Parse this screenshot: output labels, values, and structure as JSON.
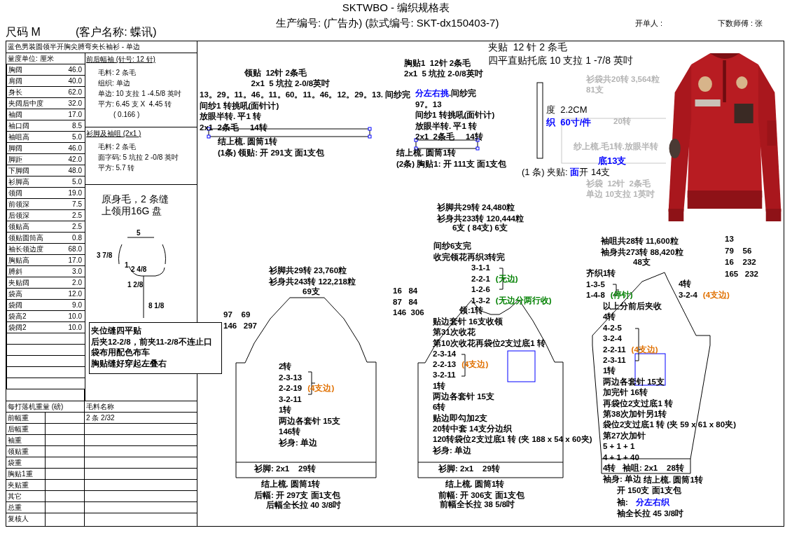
{
  "header": {
    "title": "SKTWBO - 编织规格表",
    "production_no": "生产编号: (广告办) (款式编号: SKT-dx150403-7)",
    "issuer": "开单人 :",
    "knitter": "下数师傅 : 张",
    "size": "尺码  M",
    "customer": "(客户名称: 蝶讯)"
  },
  "table": {
    "title": "蓝色男装圆领半开胸尖膊弯夹长袖衫 - 单边",
    "unit": "量度单位: 厘米",
    "measurements": [
      {
        "label": "胸阔",
        "value": "46.0"
      },
      {
        "label": "肩阔",
        "value": "40.0"
      },
      {
        "label": "身长",
        "value": "62.0"
      },
      {
        "label": "夹阔后中度",
        "value": "32.0"
      },
      {
        "label": "袖阔",
        "value": "17.0"
      },
      {
        "label": "袖口阔",
        "value": "8.5"
      },
      {
        "label": "袖咀高",
        "value": "5.0"
      },
      {
        "label": "脚阔",
        "value": "46.0"
      },
      {
        "label": "脚距",
        "value": "42.0"
      },
      {
        "label": "下脚阔",
        "value": "48.0"
      },
      {
        "label": "衫脚高",
        "value": "5.0"
      },
      {
        "label": "领阔",
        "value": "19.0"
      },
      {
        "label": "前领深",
        "value": "7.5"
      },
      {
        "label": "后领深",
        "value": "2.5"
      },
      {
        "label": "领贴高",
        "value": "2.5"
      },
      {
        "label": "领贴圆筒高",
        "value": "0.8"
      },
      {
        "label": "袖长领边度",
        "value": "68.0"
      },
      {
        "label": "胸贴高",
        "value": "17.0"
      },
      {
        "label": "膊斜",
        "value": "3.0"
      },
      {
        "label": "夹贴阔",
        "value": "2.0"
      },
      {
        "label": "袋高",
        "value": "12.0"
      },
      {
        "label": "袋阔",
        "value": "9.0"
      },
      {
        "label": "袋高2",
        "value": "10.0"
      },
      {
        "label": "袋阔2",
        "value": "10.0"
      }
    ]
  },
  "body_spec": {
    "heading": "前后幅袖 (针号: 12 针)",
    "lines": [
      "毛料: 2 条毛",
      "组织: 单边",
      "单边: 10 支拉 1 -4.5/8 英吋",
      "平方: 6.45 支 X  4.45 转",
      "( 0.166 )"
    ]
  },
  "rib_spec": {
    "heading": "衫脚及袖咀 (2x1  )",
    "lines": [
      "毛料: 2 条毛",
      "面字码: 5 坑拉 2 -0/8 英吋",
      "平方: 5.7 转"
    ]
  },
  "collar_note": [
    "原身毛，2 条缝",
    "上领用16G 盘"
  ],
  "neck_dims": [
    "5",
    "3 7/8",
    "1",
    "2 4/8",
    "1 2/8",
    "8 1/8"
  ],
  "sewing_note": [
    "夹位缝四平贴",
    "后夹12-2/8，前夹11-2/8不连止口",
    "袋布用配色布车",
    "胸贴缝好穿起左叠右"
  ],
  "weights": {
    "heading": "每打落机重量 (磅)",
    "yarn_heading": "毛料名称",
    "rows": [
      {
        "label": "前幅重",
        "yarn": "2 条 2/32"
      },
      {
        "label": "后幅重"
      },
      {
        "label": "袖重"
      },
      {
        "label": "领贴重"
      },
      {
        "label": "袋重"
      },
      {
        "label": "胸贴1重"
      },
      {
        "label": "夹贴重"
      },
      {
        "label": "其它"
      },
      {
        "label": "总重"
      },
      {
        "label": "复核人"
      }
    ]
  },
  "notes": [
    {
      "kind": "bold",
      "lines": [
        "领贴  12针 2条毛",
        "   2x1  5 坑拉 2-0/8英吋"
      ]
    },
    {
      "kind": "bold",
      "lines": [
        "13。29。11。46。11。60。11。46。12。29。13. 间纱完",
        "间纱1 转挑吼(面针计)",
        "放眼半转. 平1 转",
        "2x1  2条毛     14转"
      ]
    },
    {
      "kind": "bold",
      "lines": [
        "结上梳. 圆筒1转",
        "(1条) 领贴: 开 291支 面1支包"
      ]
    },
    {
      "kind": "bold",
      "lines": [
        "胸贴1  12针 2条毛",
        "2x1  5 坑拉 2-0/8英吋"
      ]
    },
    {
      "kind": "bold",
      "lines": [
        {
          "segments": [
            {
              "text": "分左右挑",
              "color": "#0000ff"
            },
            {
              "text": ".间纱完"
            }
          ]
        },
        "97。13",
        "间纱1 转挑吼(面针计)",
        "放眼半转. 平1 转",
        "2x1  2条毛     14转"
      ]
    },
    {
      "kind": "bold",
      "lines": [
        "结上梳. 圆筒1转",
        "(2条) 胸贴1: 开 111支 面1支包"
      ]
    },
    {
      "kind": "large",
      "lines": [
        "夹贴  12 针 2 条毛",
        "四平直贴托底 10 支拉 1 -7/8 英吋"
      ]
    },
    {
      "kind": "faded",
      "lines": [
        "衫袋共20转 3,564粒",
        "81支"
      ]
    },
    {
      "kind": "plain",
      "lines": [
        "度  2.2CM",
        {
          "segments": [
            {
              "text": "织  60寸/件",
              "color": "#0000ff"
            }
          ]
        }
      ]
    },
    {
      "kind": "faded",
      "lines": [
        "20转"
      ]
    },
    {
      "kind": "faded",
      "lines": [
        "纱上梳.毛1转.放眼半转"
      ]
    },
    {
      "kind": "plain",
      "lines": [
        {
          "segments": [
            {
              "text": "底13支",
              "color": "#0000ff"
            }
          ]
        }
      ]
    },
    {
      "kind": "plain",
      "lines": [
        {
          "segments": [
            {
              "text": "(1 条) 夹贴: "
            },
            {
              "text": "面",
              "color": "#0000ff"
            },
            {
              "text": "开 14支"
            }
          ]
        }
      ]
    },
    {
      "kind": "faded",
      "lines": [
        "衫袋  12针  2条毛",
        "单边 10支拉 1英吋"
      ]
    },
    {
      "kind": "bold",
      "lines": [
        "衫脚共29转 23,760粒",
        "衫身共243转 122,218粒"
      ]
    },
    {
      "kind": "bold",
      "lines": [
        "69支"
      ]
    },
    {
      "kind": "bold",
      "lines": [
        "97    69",
        "146   297"
      ]
    },
    {
      "kind": "bold",
      "lines": [
        "2转",
        "2-3-13",
        {
          "segments": [
            {
              "text": "2-2-19"
            },
            {
              "text": "(4支边)",
              "color": "#e07000"
            }
          ]
        },
        "3-2-11",
        "1转",
        "两边各套针 15支",
        "146转",
        "衫身: 单边"
      ]
    },
    {
      "kind": "bold",
      "lines": [
        "衫脚: 2x1    29转"
      ]
    },
    {
      "kind": "bold",
      "lines": [
        "   结上梳. 圆筒1转",
        "后幅: 开 297支 面1支包"
      ]
    },
    {
      "kind": "bold",
      "lines": [
        "后幅全长拉 40 3/8吋"
      ]
    },
    {
      "kind": "bold",
      "lines": [
        "衫脚共29转 24,480粒",
        "衫身共233转 120,444粒"
      ]
    },
    {
      "kind": "bold",
      "lines": [
        "6支 ( 84支) 6支"
      ]
    },
    {
      "kind": "bold",
      "lines": [
        "16   84",
        "87   84",
        "146  306"
      ]
    },
    {
      "kind": "bold",
      "lines": [
        "间纱6支完",
        "收完领花再织3转完"
      ]
    },
    {
      "kind": "bold",
      "lines": [
        "3-1-1",
        {
          "segments": [
            {
              "text": "2-2-1"
            },
            {
              "text": "(无边)",
              "color": "#008000"
            }
          ]
        },
        "1-2-6",
        {
          "segments": [
            {
              "text": "1-3-2"
            },
            {
              "text": "(无边分两行收)",
              "color": "#008000"
            }
          ]
        }
      ]
    },
    {
      "kind": "bold",
      "lines": [
        "领:1转"
      ]
    },
    {
      "kind": "bold",
      "lines": [
        "贴边套针 16支收领",
        "第31次收花",
        "第10次收花再袋位2支过底1 转",
        "2-3-14",
        {
          "segments": [
            {
              "text": "2-2-13"
            },
            {
              "text": "(4支边)",
              "color": "#e07000"
            }
          ]
        },
        "3-2-11",
        "1转",
        "两边各套针 15支",
        "6转",
        "贴边即勾加2支",
        "20转中套 14支分边织",
        "120转袋位2支过底1 转 (夹 188 x 54 x 60夹)",
        "衫身: 单边"
      ]
    },
    {
      "kind": "bold",
      "lines": [
        "衫脚: 2x1    29转"
      ]
    },
    {
      "kind": "bold",
      "lines": [
        "   结上梳. 圆筒1转",
        "前幅: 开 306支 面1支包"
      ]
    },
    {
      "kind": "bold",
      "lines": [
        "前幅全长拉 38 5/8吋"
      ]
    },
    {
      "kind": "bold",
      "lines": [
        "袖咀共28转 11,600粒",
        "袖身共273转 88,420粒"
      ]
    },
    {
      "kind": "bold",
      "lines": [
        "48支"
      ]
    },
    {
      "kind": "bold",
      "lines": [
        "13",
        "79    56",
        "16    232",
        "165   232"
      ]
    },
    {
      "kind": "bold",
      "lines": [
        "齐织1转",
        "1-3-5",
        {
          "segments": [
            {
              "text": "1-4-8"
            },
            {
              "text": "(停针)",
              "color": "#008000"
            }
          ]
        }
      ]
    },
    {
      "kind": "bold",
      "lines": [
        "4转",
        {
          "segments": [
            {
              "text": "3-2-4"
            },
            {
              "text": "(4支边)",
              "color": "#e07000"
            }
          ]
        }
      ]
    },
    {
      "kind": "bold",
      "lines": [
        "以上分前后夹收",
        "4转",
        "4-2-5",
        "3-2-4",
        {
          "segments": [
            {
              "text": "2-2-11"
            },
            {
              "text": "(4支边)",
              "color": "#e07000"
            }
          ]
        },
        "2-3-11",
        "1转",
        "两边各套针 15支",
        "加完针 16转",
        "再袋位2支过底1 转",
        "第38次加针另1转",
        "袋位2支过底1 转 (夹 59 x 61 x 80夹)",
        "第27次加针",
        "5 + 1 + 1",
        "4 + 1 + 40",
        "4转",
        "袖身: 单边"
      ]
    },
    {
      "kind": "bold",
      "lines": [
        "袖咀: 2x1    28转"
      ]
    },
    {
      "kind": "bold",
      "lines": [
        "结上梳. 圆筒1转"
      ]
    },
    {
      "kind": "bold",
      "lines": [
        "开 150支 面1支包",
        {
          "segments": [
            {
              "text": "袖: "
            },
            {
              "text": "分左右织",
              "color": "#0000ff"
            }
          ]
        },
        "袖全长拉 45 3/8吋"
      ]
    }
  ]
}
